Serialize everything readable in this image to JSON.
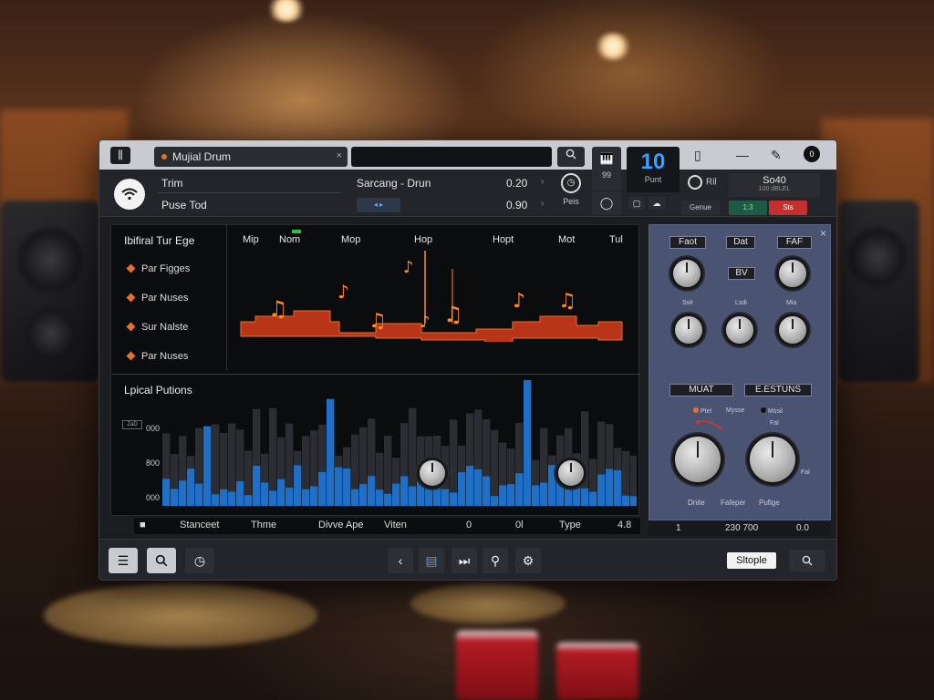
{
  "app": {
    "tab_title": "Mujial Drum",
    "search_button": "Q",
    "close_tab": "×"
  },
  "tracks": [
    {
      "name": "Trim",
      "center": "Sarcang - Drun",
      "value": "0.20"
    },
    {
      "name": "Puse Tod",
      "center": "",
      "value": "0.90"
    }
  ],
  "header_controls": {
    "clock_label": "Peis",
    "piano_num": "99",
    "counter_value": "10",
    "counter_label": "Punt",
    "power_label": "Ril",
    "sog_value": "So40",
    "sog_sub": "100 dBLEL",
    "btn_gen": "Genue",
    "btn_num": "1:3",
    "btn_red": "Sts"
  },
  "notes_panel": {
    "title": "Ibifiral Tur Ege",
    "items": [
      "Par Figges",
      "Par Nuses",
      "Sur Nalste",
      "Par Nuses"
    ],
    "columns": [
      "Mip",
      "Nom",
      "Mop",
      "Hop",
      "Hopt",
      "Mot",
      "Tul"
    ]
  },
  "spectrum": {
    "title": "Lpical Putions",
    "y_labels": [
      "000",
      "800",
      "000"
    ],
    "y_box": "ZaD"
  },
  "transport": {
    "labels": [
      "Stanceet",
      "Thme",
      "Divve Ape",
      "Viten",
      "0",
      "0l",
      "Type",
      "4.8"
    ]
  },
  "right_panel": {
    "top_labels": [
      "Faot",
      "Dat",
      "FAF"
    ],
    "center_badge": "BV",
    "small_caps": [
      "Ssit",
      "Lsdi",
      "Mia"
    ],
    "mid_labels": [
      "MUAT",
      "E.ESTUNS"
    ],
    "radio_a": "Ptel",
    "radio_b": "Mysse",
    "radio_c": "Mssil",
    "pointer_label": "Fal",
    "bottom_caps": [
      "Dnite",
      "Fafeper",
      "Pufige"
    ],
    "side_cap": "Fal",
    "footer": [
      "1",
      "230 700",
      "0.0"
    ]
  },
  "bottom": {
    "simple_label": "Sltople"
  },
  "icons": [
    "menu-icon",
    "wifi-icon",
    "clock-icon",
    "piano-icon",
    "chat-icon",
    "power-icon",
    "phone-icon",
    "minus-icon",
    "pen-icon",
    "record-icon",
    "list-icon",
    "search-icon",
    "history-icon",
    "back-icon",
    "folder-icon",
    "skip-icon",
    "key-icon",
    "gear-icon"
  ],
  "colors": {
    "accent_orange": "#e8702a",
    "accent_blue": "#3aa0ff",
    "spectrum_blue": "#1f6fc6",
    "panel_blue": "#4b5372",
    "record_red": "#c23030",
    "green": "#2fbf4a"
  }
}
